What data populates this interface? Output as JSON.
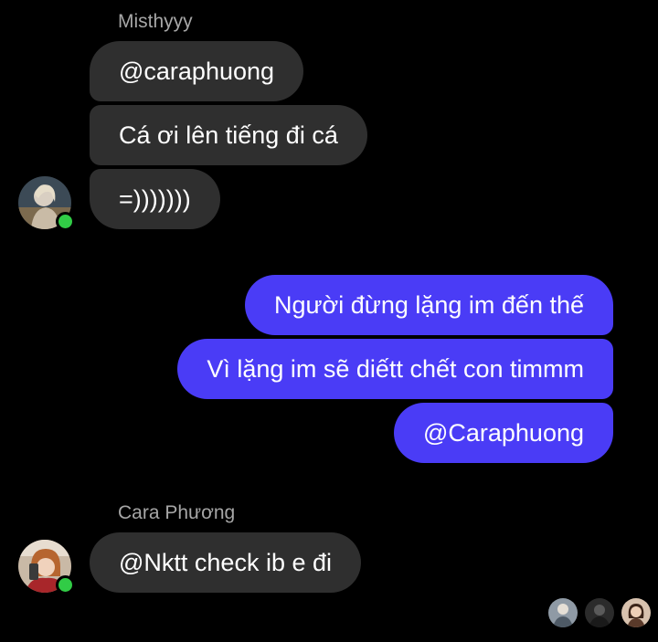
{
  "colors": {
    "background": "#000000",
    "incoming_bubble": "#2f2f2f",
    "outgoing_bubble": "#4a3cf6",
    "sender_name": "#a6a6a6",
    "online_dot": "#31cc46"
  },
  "groups": [
    {
      "sender": "Misthyyy",
      "messages": [
        "@caraphuong",
        "Cá ơi lên tiếng đi cá",
        "=)))))))"
      ],
      "avatar": "avatar-misthyyy",
      "online": true
    },
    {
      "sender": "",
      "messages": [
        "Người đừng lặng im đến thế",
        "Vì lặng im sẽ diếtt chết con timmm",
        "@Caraphuong"
      ]
    },
    {
      "sender": "Cara Phương",
      "messages": [
        "@Nktt check ib e đi"
      ],
      "avatar": "avatar-cara-phuong",
      "online": true
    }
  ],
  "seen_by": [
    "seen-avatar-1",
    "seen-avatar-2",
    "seen-avatar-3"
  ]
}
